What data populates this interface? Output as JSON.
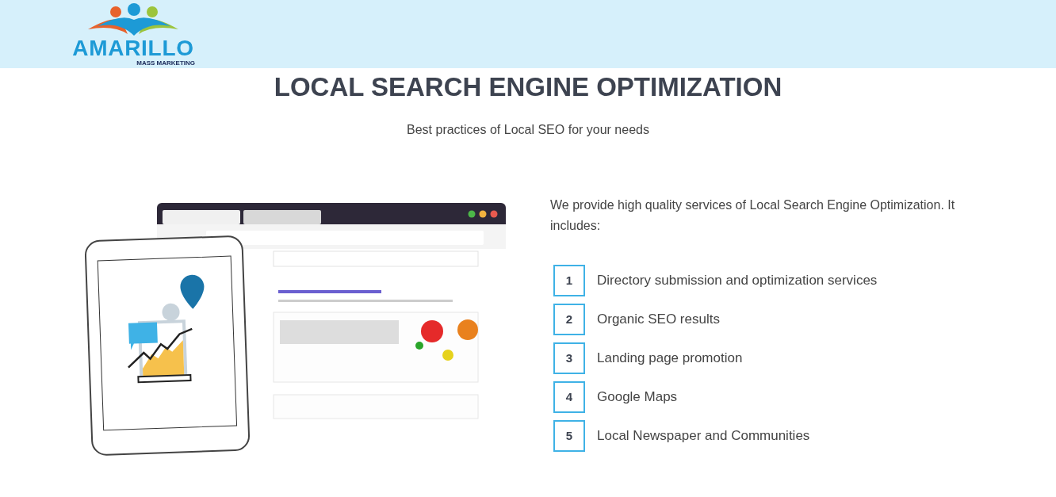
{
  "header": {
    "logo": {
      "name": "AMARILLO",
      "tagline": "MASS MARKETING"
    }
  },
  "hero": {
    "title": "LOCAL SEARCH ENGINE OPTIMIZATION",
    "subtitle": "Best practices of Local SEO for your needs"
  },
  "services": {
    "intro": "We provide high quality services of Local Search Engine Optimization. It includes:",
    "items": [
      {
        "number": "1",
        "label": "Directory submission and optimization services"
      },
      {
        "number": "2",
        "label": "Organic SEO results"
      },
      {
        "number": "3",
        "label": "Landing page promotion"
      },
      {
        "number": "4",
        "label": "Google Maps"
      },
      {
        "number": "5",
        "label": "Local Newspaper and Communities"
      }
    ]
  }
}
